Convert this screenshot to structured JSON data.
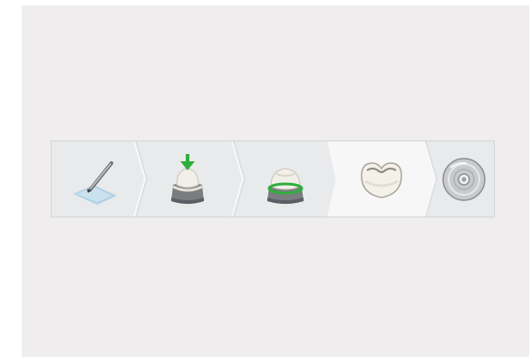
{
  "workflow": {
    "steps": [
      {
        "icon": "scan-pen-icon",
        "state": "done"
      },
      {
        "icon": "insertion-axis-icon",
        "state": "done"
      },
      {
        "icon": "margin-line-icon",
        "state": "done"
      },
      {
        "icon": "crown-design-icon",
        "state": "active"
      },
      {
        "icon": "disc-export-icon",
        "state": "pending"
      }
    ]
  },
  "colors": {
    "background": "#efedee",
    "bar": "#e9eaec",
    "active_step": "#f7f7f8",
    "green": "#2fae3c"
  }
}
